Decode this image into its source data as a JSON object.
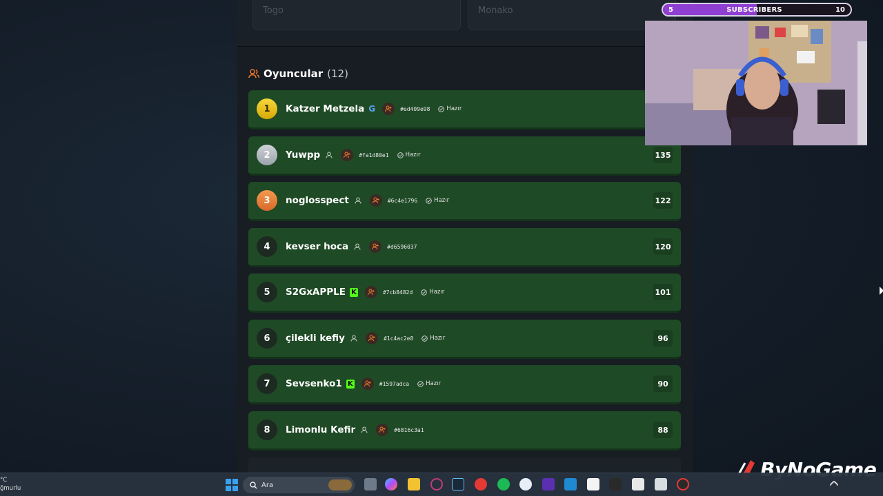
{
  "countries": [
    "Togo",
    "Monako"
  ],
  "players_section": {
    "title": "Oyuncular",
    "count": "(12)"
  },
  "ready_label": "Hazır",
  "players": [
    {
      "rank": "1",
      "name": "Katzer Metzela",
      "badge": "google",
      "id": "#ed409e98",
      "ready": true,
      "score": ""
    },
    {
      "rank": "2",
      "name": "Yuwpp",
      "badge": "user",
      "id": "#fa1d80e1",
      "ready": true,
      "score": "135"
    },
    {
      "rank": "3",
      "name": "noglosspect",
      "badge": "user",
      "id": "#6c4e1796",
      "ready": true,
      "score": "122"
    },
    {
      "rank": "4",
      "name": "kevser hoca",
      "badge": "user",
      "id": "#d6596037",
      "ready": false,
      "score": "120"
    },
    {
      "rank": "5",
      "name": "S2GxAPPLE",
      "badge": "kick",
      "id": "#7cb8482d",
      "ready": true,
      "score": "101"
    },
    {
      "rank": "6",
      "name": "çilekli kefiy",
      "badge": "user",
      "id": "#1c4ac2e8",
      "ready": true,
      "score": "96"
    },
    {
      "rank": "7",
      "name": "Sevsenko1",
      "badge": "kick",
      "id": "#1597adca",
      "ready": true,
      "score": "90"
    },
    {
      "rank": "8",
      "name": "Limonlu Kefir",
      "badge": "user",
      "id": "#6816c3a1",
      "ready": false,
      "score": "88"
    }
  ],
  "subscribers": {
    "current": "5",
    "label": "SUBSCRIBERS",
    "goal": "10",
    "progress": 0.5
  },
  "taskbar": {
    "search_placeholder": "Ara",
    "left_text_1": "°C",
    "left_text_2": "ğmurlu"
  },
  "watermark": "ByNoGame",
  "colors": {
    "row_green": "#1f4a26",
    "accent_orange": "#f07a2a",
    "kick_green": "#53fc18",
    "sub_purple": "#8f3fd1"
  }
}
